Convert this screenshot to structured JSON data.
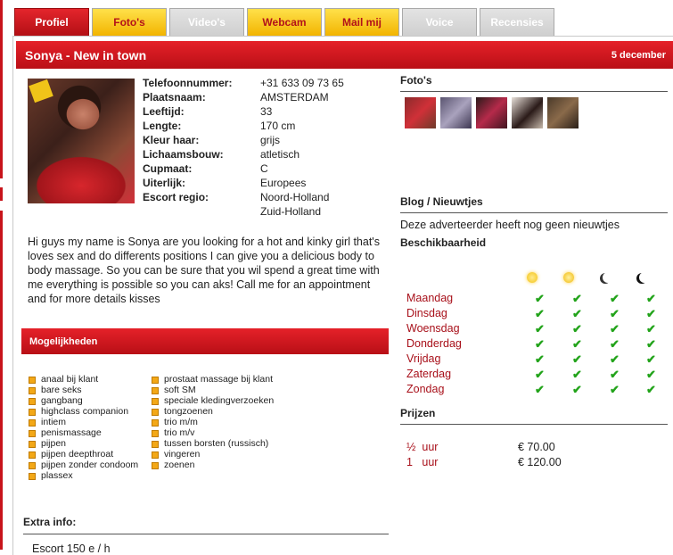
{
  "tabs": [
    {
      "label": "Profiel",
      "state": "active"
    },
    {
      "label": "Foto's",
      "state": "enabled"
    },
    {
      "label": "Video's",
      "state": "disabled"
    },
    {
      "label": "Webcam",
      "state": "enabled"
    },
    {
      "label": "Mail mij",
      "state": "enabled"
    },
    {
      "label": "Voice",
      "state": "disabled"
    },
    {
      "label": "Recensies",
      "state": "disabled"
    }
  ],
  "profile": {
    "title": "Sonya - New in town",
    "date": "5 december",
    "details": [
      {
        "label": "Telefoonnummer:",
        "value": "+31 633 09 73 65"
      },
      {
        "label": "Plaatsnaam:",
        "value": "AMSTERDAM"
      },
      {
        "label": "Leeftijd:",
        "value": "33"
      },
      {
        "label": "Lengte:",
        "value": "170 cm"
      },
      {
        "label": "Kleur haar:",
        "value": "grijs"
      },
      {
        "label": "Lichaamsbouw:",
        "value": "atletisch"
      },
      {
        "label": "Cupmaat:",
        "value": "C"
      },
      {
        "label": "Uiterlijk:",
        "value": "Europees"
      },
      {
        "label": "Escort regio:",
        "value": "Noord-Holland"
      },
      {
        "label": "",
        "value": "Zuid-Holland"
      }
    ],
    "about": "Hi guys my name is Sonya are you looking for a hot and kinky girl that's loves sex and do differents positions I can give you a delicious body to body massage. So you can be sure that you wil spend a great time with me everything is possible so you can aks! Call me for an appointment and for more details kisses"
  },
  "mogelijkheden": {
    "title": "Mogelijkheden",
    "col1": [
      "anaal bij klant",
      "bare seks",
      "gangbang",
      "highclass companion",
      "intiem",
      "penismassage",
      "pijpen",
      "pijpen deepthroat",
      "pijpen zonder condoom",
      "plassex"
    ],
    "col2": [
      "prostaat massage bij klant",
      "soft SM",
      "speciale kledingverzoeken",
      "tongzoenen",
      "trio m/m",
      "trio m/v",
      "tussen borsten (russisch)",
      "vingeren",
      "zoenen"
    ]
  },
  "extra": {
    "title": "Extra info:",
    "value": "Escort 150 e / h"
  },
  "right": {
    "fotos_title": "Foto's",
    "blog_title": "Blog / Nieuwtjes",
    "no_news": "Deze adverteerder heeft nog geen nieuwtjes",
    "beschik_title": "Beschikbaarheid",
    "days": [
      "Maandag",
      "Dinsdag",
      "Woensdag",
      "Donderdag",
      "Vrijdag",
      "Zaterdag",
      "Zondag"
    ],
    "check": "✔",
    "prijzen_title": "Prijzen",
    "prices": [
      {
        "duration": "½  uur",
        "price": "€ 70.00"
      },
      {
        "duration": "1   uur",
        "price": "€ 120.00"
      }
    ]
  },
  "colors": {
    "accent_red": "#c8141b",
    "tab_yellow": "#f5c518",
    "check_green": "#22a31a"
  }
}
